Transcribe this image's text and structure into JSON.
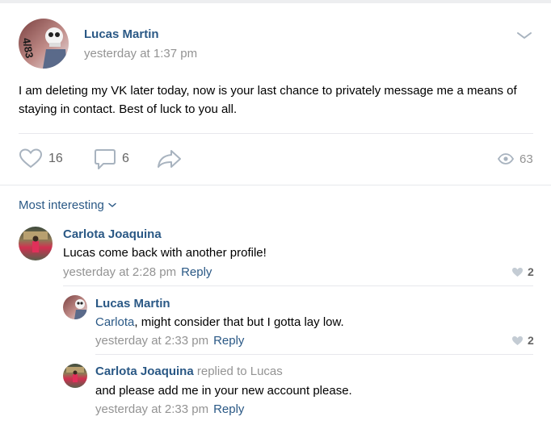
{
  "post": {
    "author": "Lucas Martin",
    "time": "yesterday at 1:37 pm",
    "avatar_text": "4/83",
    "text": "I am deleting my VK later today, now is your last chance to privately message me a means of staying in contact. Best of luck to you all.",
    "likes": "16",
    "comments": "6",
    "views": "63"
  },
  "sort": {
    "label": "Most interesting"
  },
  "comments": [
    {
      "author": "Carlota Joaquina",
      "text": "Lucas come back with another profile!",
      "time": "yesterday at 2:28 pm",
      "reply_label": "Reply",
      "likes": "2"
    },
    {
      "author": "Lucas Martin",
      "mention": "Carlota",
      "text": ", might consider that but I gotta lay low.",
      "time": "yesterday at 2:33 pm",
      "reply_label": "Reply",
      "likes": "2"
    },
    {
      "author": "Carlota Joaquina",
      "replied_to": "replied to Lucas",
      "text": "and please add me in your new account please.",
      "time": "yesterday at 2:33 pm",
      "reply_label": "Reply"
    }
  ],
  "colors": {
    "link": "#2a5885",
    "muted": "#939393",
    "icon": "#a8b3bf",
    "separator": "#e7e8ec"
  }
}
